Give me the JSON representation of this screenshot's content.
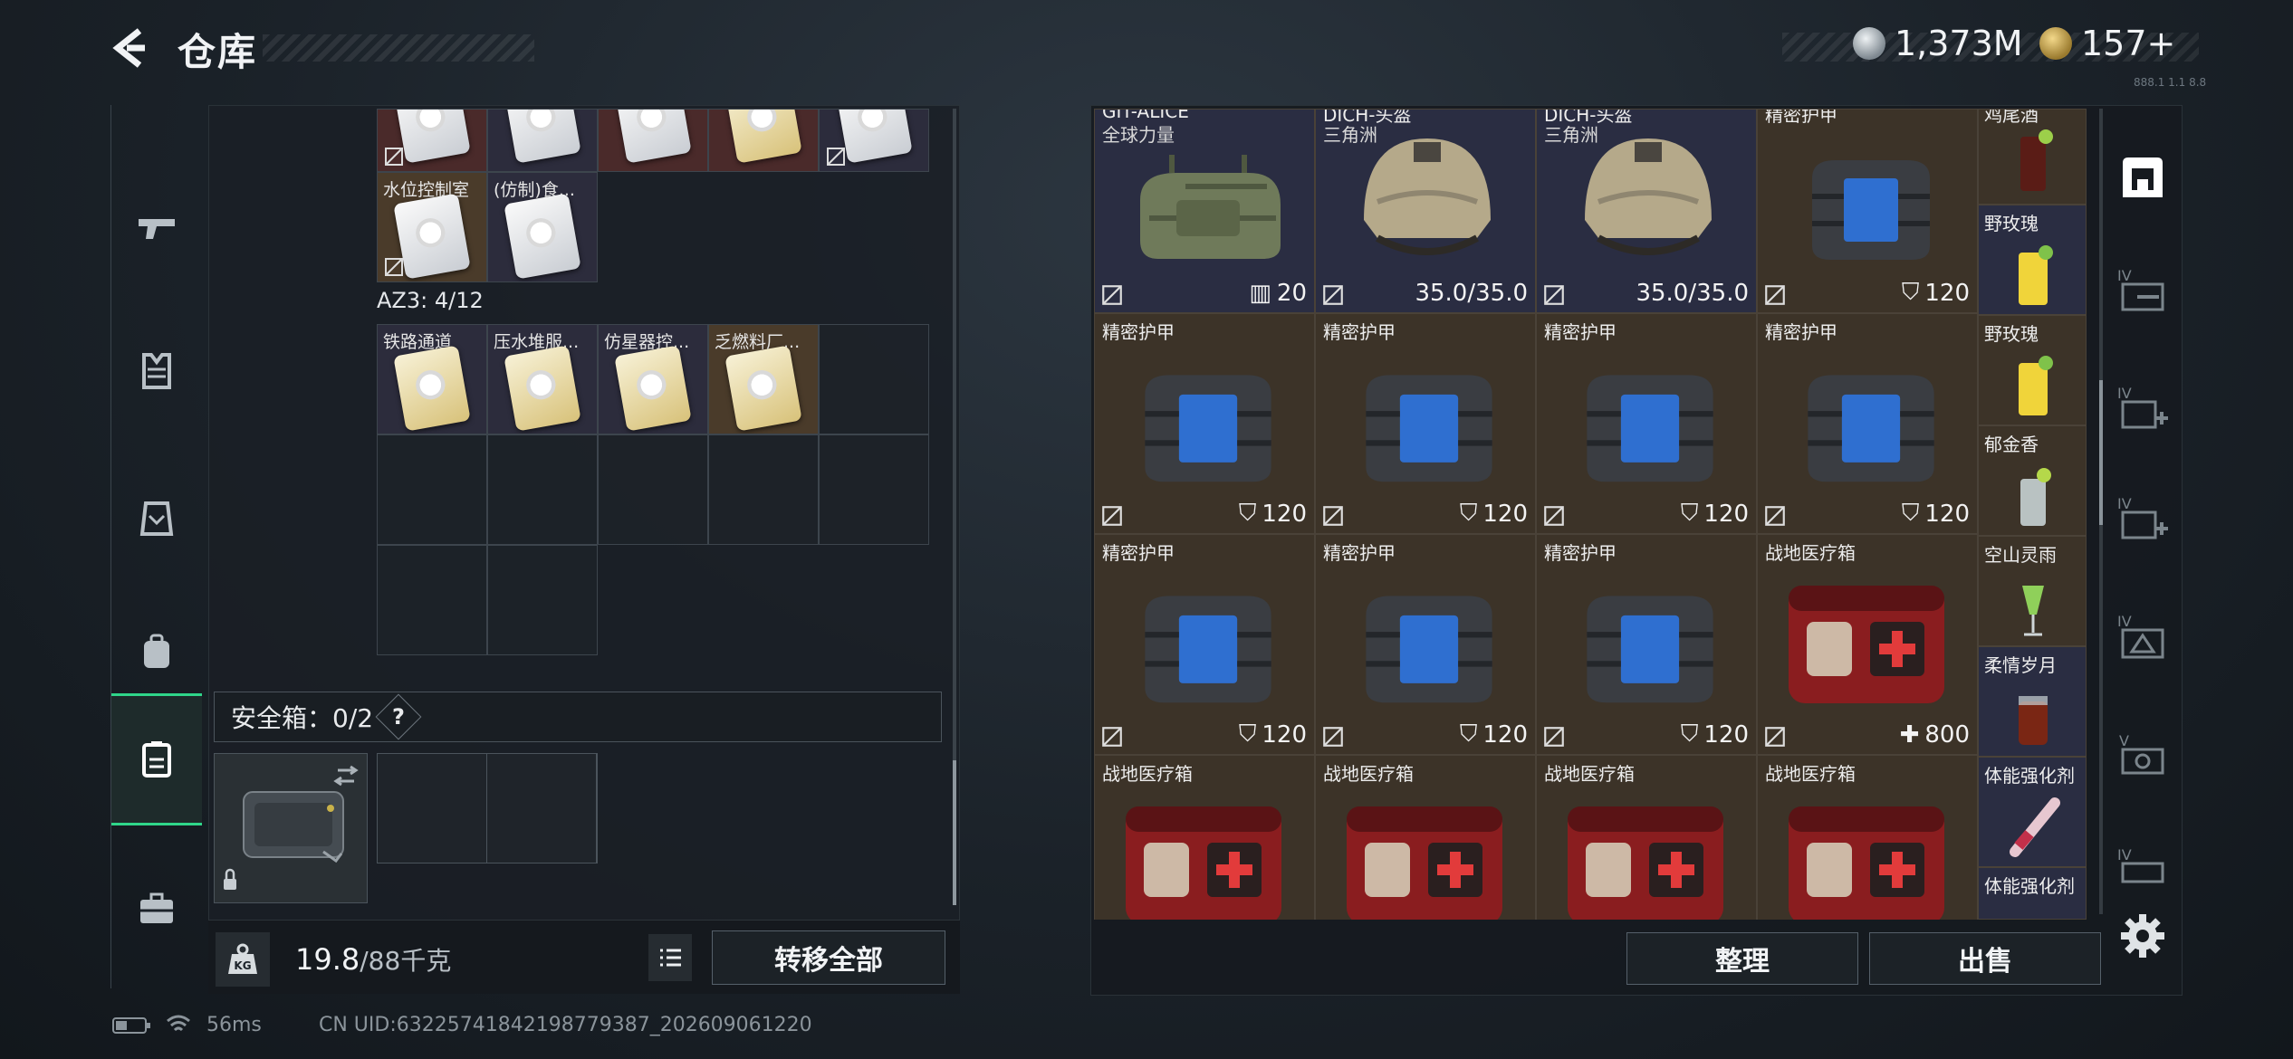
{
  "header": {
    "title": "仓库",
    "currency_a": "1,373M",
    "currency_b": "157+",
    "version": "888.1 1.1 8.8"
  },
  "left_nav": {
    "items": [
      {
        "id": "weapons",
        "icon": "pistol-icon"
      },
      {
        "id": "armor",
        "icon": "vest-icon"
      },
      {
        "id": "chest-rig",
        "icon": "rig-icon"
      },
      {
        "id": "backpack",
        "icon": "backpack-icon"
      },
      {
        "id": "safebox",
        "icon": "safebox-icon",
        "active": true
      },
      {
        "id": "toolbox",
        "icon": "briefcase-icon"
      }
    ]
  },
  "container": {
    "row1_names": [
      "水位控制室",
      "(仿制)食..."
    ],
    "section_label": "AZ3: 4/12",
    "az3_names": [
      "铁路通道",
      "压水堆服...",
      "仿星器控...",
      "乏燃料厂..."
    ],
    "safebox_label": "安全箱：0/2",
    "help": "?",
    "weight_current": "19.8",
    "weight_max": "/88千克",
    "transfer_all": "转移全部"
  },
  "warehouse": {
    "row0": [
      {
        "name": "GIT-ALICE",
        "sub": "全球力量",
        "badge": "20"
      },
      {
        "name": "DICH-头盔",
        "sub": "三角洲",
        "badge": "35.0/35.0"
      },
      {
        "name": "DICH-头盔",
        "sub": "三角洲",
        "badge": "35.0/35.0"
      },
      {
        "name": "精密护甲",
        "sub": "",
        "badge": "120"
      }
    ],
    "row1": [
      {
        "name": "精密护甲",
        "badge": "120"
      },
      {
        "name": "精密护甲",
        "badge": "120"
      },
      {
        "name": "精密护甲",
        "badge": "120"
      },
      {
        "name": "精密护甲",
        "badge": "120"
      }
    ],
    "row2": [
      {
        "name": "精密护甲",
        "badge": "120"
      },
      {
        "name": "精密护甲",
        "badge": "120"
      },
      {
        "name": "精密护甲",
        "badge": "120"
      },
      {
        "name": "战地医疗箱",
        "badge": "800"
      }
    ],
    "row3": [
      {
        "name": "战地医疗箱"
      },
      {
        "name": "战地医疗箱"
      },
      {
        "name": "战地医疗箱"
      },
      {
        "name": "战地医疗箱"
      }
    ],
    "drinks": [
      "鸡尾酒",
      "野玫瑰",
      "野玫瑰",
      "郁金香",
      "空山灵雨",
      "柔情岁月",
      "体能强化剂",
      "体能强化剂"
    ],
    "sort": "整理",
    "sell": "出售"
  },
  "right_categories": [
    {
      "icon": "all-items-icon"
    },
    {
      "icon": "tier4-gun-icon",
      "tier": "IV"
    },
    {
      "icon": "tier4-medkit-icon",
      "tier": "IV"
    },
    {
      "icon": "tier4-heal-icon",
      "tier": "IV"
    },
    {
      "icon": "tier4-ammo-icon",
      "tier": "IV"
    },
    {
      "icon": "tier5-icon",
      "tier": "V"
    },
    {
      "icon": "tier-misc-icon",
      "tier": "IV"
    }
  ],
  "status": {
    "ping": "56ms",
    "uid": "CN UID:6322574184219877​9387_202609061220"
  },
  "colors": {
    "accent_green": "#2fd68a",
    "gold_cell": "#4a3b2a",
    "navy_cell": "#2c2c3c"
  }
}
